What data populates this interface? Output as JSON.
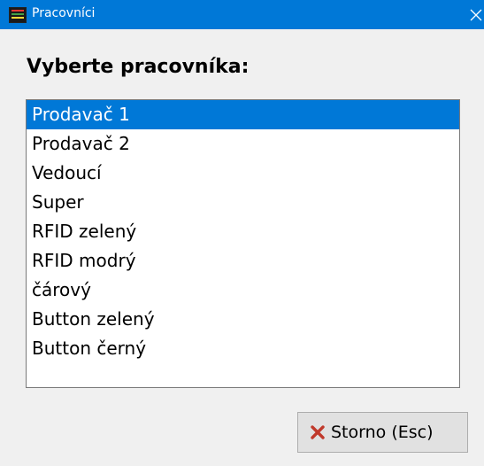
{
  "window": {
    "title": "Pracovníci",
    "icon": "app-icon",
    "close_icon": "close-icon"
  },
  "prompt": "Vyberte pracovníka:",
  "list": {
    "items": [
      "Prodavač 1",
      "Prodavač 2",
      "Vedoucí",
      "Super",
      "RFID zelený",
      "RFID modrý",
      "čárový",
      "Button zelený",
      "Button černý"
    ],
    "selected_index": 0
  },
  "cancel_button": {
    "label": "Storno (Esc)",
    "icon": "x-icon",
    "icon_color": "#c0392b"
  },
  "colors": {
    "titlebar": "#0078d7",
    "selection": "#0078d7"
  }
}
